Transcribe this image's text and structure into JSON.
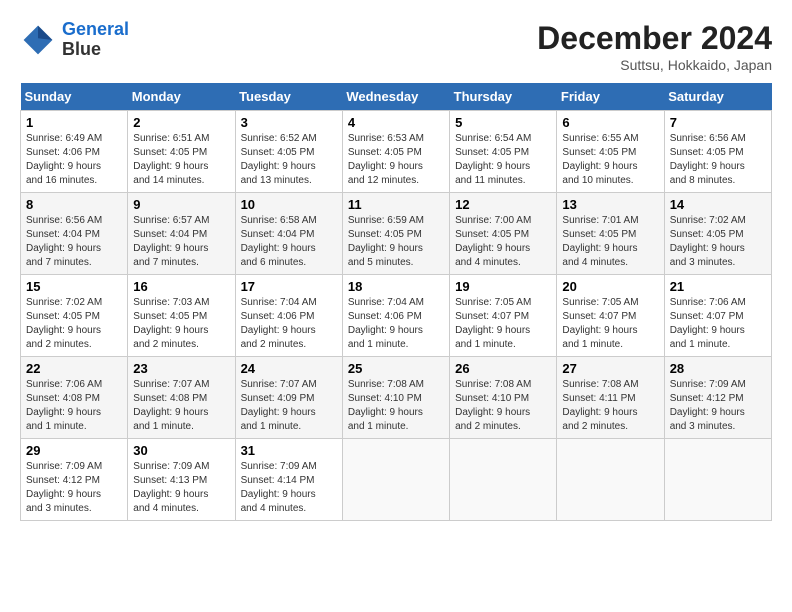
{
  "header": {
    "logo_line1": "General",
    "logo_line2": "Blue",
    "month": "December 2024",
    "location": "Suttsu, Hokkaido, Japan"
  },
  "days_of_week": [
    "Sunday",
    "Monday",
    "Tuesday",
    "Wednesday",
    "Thursday",
    "Friday",
    "Saturday"
  ],
  "weeks": [
    [
      {
        "day": "1",
        "info": "Sunrise: 6:49 AM\nSunset: 4:06 PM\nDaylight: 9 hours\nand 16 minutes."
      },
      {
        "day": "2",
        "info": "Sunrise: 6:51 AM\nSunset: 4:05 PM\nDaylight: 9 hours\nand 14 minutes."
      },
      {
        "day": "3",
        "info": "Sunrise: 6:52 AM\nSunset: 4:05 PM\nDaylight: 9 hours\nand 13 minutes."
      },
      {
        "day": "4",
        "info": "Sunrise: 6:53 AM\nSunset: 4:05 PM\nDaylight: 9 hours\nand 12 minutes."
      },
      {
        "day": "5",
        "info": "Sunrise: 6:54 AM\nSunset: 4:05 PM\nDaylight: 9 hours\nand 11 minutes."
      },
      {
        "day": "6",
        "info": "Sunrise: 6:55 AM\nSunset: 4:05 PM\nDaylight: 9 hours\nand 10 minutes."
      },
      {
        "day": "7",
        "info": "Sunrise: 6:56 AM\nSunset: 4:05 PM\nDaylight: 9 hours\nand 8 minutes."
      }
    ],
    [
      {
        "day": "8",
        "info": "Sunrise: 6:56 AM\nSunset: 4:04 PM\nDaylight: 9 hours\nand 7 minutes."
      },
      {
        "day": "9",
        "info": "Sunrise: 6:57 AM\nSunset: 4:04 PM\nDaylight: 9 hours\nand 7 minutes."
      },
      {
        "day": "10",
        "info": "Sunrise: 6:58 AM\nSunset: 4:04 PM\nDaylight: 9 hours\nand 6 minutes."
      },
      {
        "day": "11",
        "info": "Sunrise: 6:59 AM\nSunset: 4:05 PM\nDaylight: 9 hours\nand 5 minutes."
      },
      {
        "day": "12",
        "info": "Sunrise: 7:00 AM\nSunset: 4:05 PM\nDaylight: 9 hours\nand 4 minutes."
      },
      {
        "day": "13",
        "info": "Sunrise: 7:01 AM\nSunset: 4:05 PM\nDaylight: 9 hours\nand 4 minutes."
      },
      {
        "day": "14",
        "info": "Sunrise: 7:02 AM\nSunset: 4:05 PM\nDaylight: 9 hours\nand 3 minutes."
      }
    ],
    [
      {
        "day": "15",
        "info": "Sunrise: 7:02 AM\nSunset: 4:05 PM\nDaylight: 9 hours\nand 2 minutes."
      },
      {
        "day": "16",
        "info": "Sunrise: 7:03 AM\nSunset: 4:05 PM\nDaylight: 9 hours\nand 2 minutes."
      },
      {
        "day": "17",
        "info": "Sunrise: 7:04 AM\nSunset: 4:06 PM\nDaylight: 9 hours\nand 2 minutes."
      },
      {
        "day": "18",
        "info": "Sunrise: 7:04 AM\nSunset: 4:06 PM\nDaylight: 9 hours\nand 1 minute."
      },
      {
        "day": "19",
        "info": "Sunrise: 7:05 AM\nSunset: 4:07 PM\nDaylight: 9 hours\nand 1 minute."
      },
      {
        "day": "20",
        "info": "Sunrise: 7:05 AM\nSunset: 4:07 PM\nDaylight: 9 hours\nand 1 minute."
      },
      {
        "day": "21",
        "info": "Sunrise: 7:06 AM\nSunset: 4:07 PM\nDaylight: 9 hours\nand 1 minute."
      }
    ],
    [
      {
        "day": "22",
        "info": "Sunrise: 7:06 AM\nSunset: 4:08 PM\nDaylight: 9 hours\nand 1 minute."
      },
      {
        "day": "23",
        "info": "Sunrise: 7:07 AM\nSunset: 4:08 PM\nDaylight: 9 hours\nand 1 minute."
      },
      {
        "day": "24",
        "info": "Sunrise: 7:07 AM\nSunset: 4:09 PM\nDaylight: 9 hours\nand 1 minute."
      },
      {
        "day": "25",
        "info": "Sunrise: 7:08 AM\nSunset: 4:10 PM\nDaylight: 9 hours\nand 1 minute."
      },
      {
        "day": "26",
        "info": "Sunrise: 7:08 AM\nSunset: 4:10 PM\nDaylight: 9 hours\nand 2 minutes."
      },
      {
        "day": "27",
        "info": "Sunrise: 7:08 AM\nSunset: 4:11 PM\nDaylight: 9 hours\nand 2 minutes."
      },
      {
        "day": "28",
        "info": "Sunrise: 7:09 AM\nSunset: 4:12 PM\nDaylight: 9 hours\nand 3 minutes."
      }
    ],
    [
      {
        "day": "29",
        "info": "Sunrise: 7:09 AM\nSunset: 4:12 PM\nDaylight: 9 hours\nand 3 minutes."
      },
      {
        "day": "30",
        "info": "Sunrise: 7:09 AM\nSunset: 4:13 PM\nDaylight: 9 hours\nand 4 minutes."
      },
      {
        "day": "31",
        "info": "Sunrise: 7:09 AM\nSunset: 4:14 PM\nDaylight: 9 hours\nand 4 minutes."
      },
      {
        "day": "",
        "info": ""
      },
      {
        "day": "",
        "info": ""
      },
      {
        "day": "",
        "info": ""
      },
      {
        "day": "",
        "info": ""
      }
    ]
  ]
}
